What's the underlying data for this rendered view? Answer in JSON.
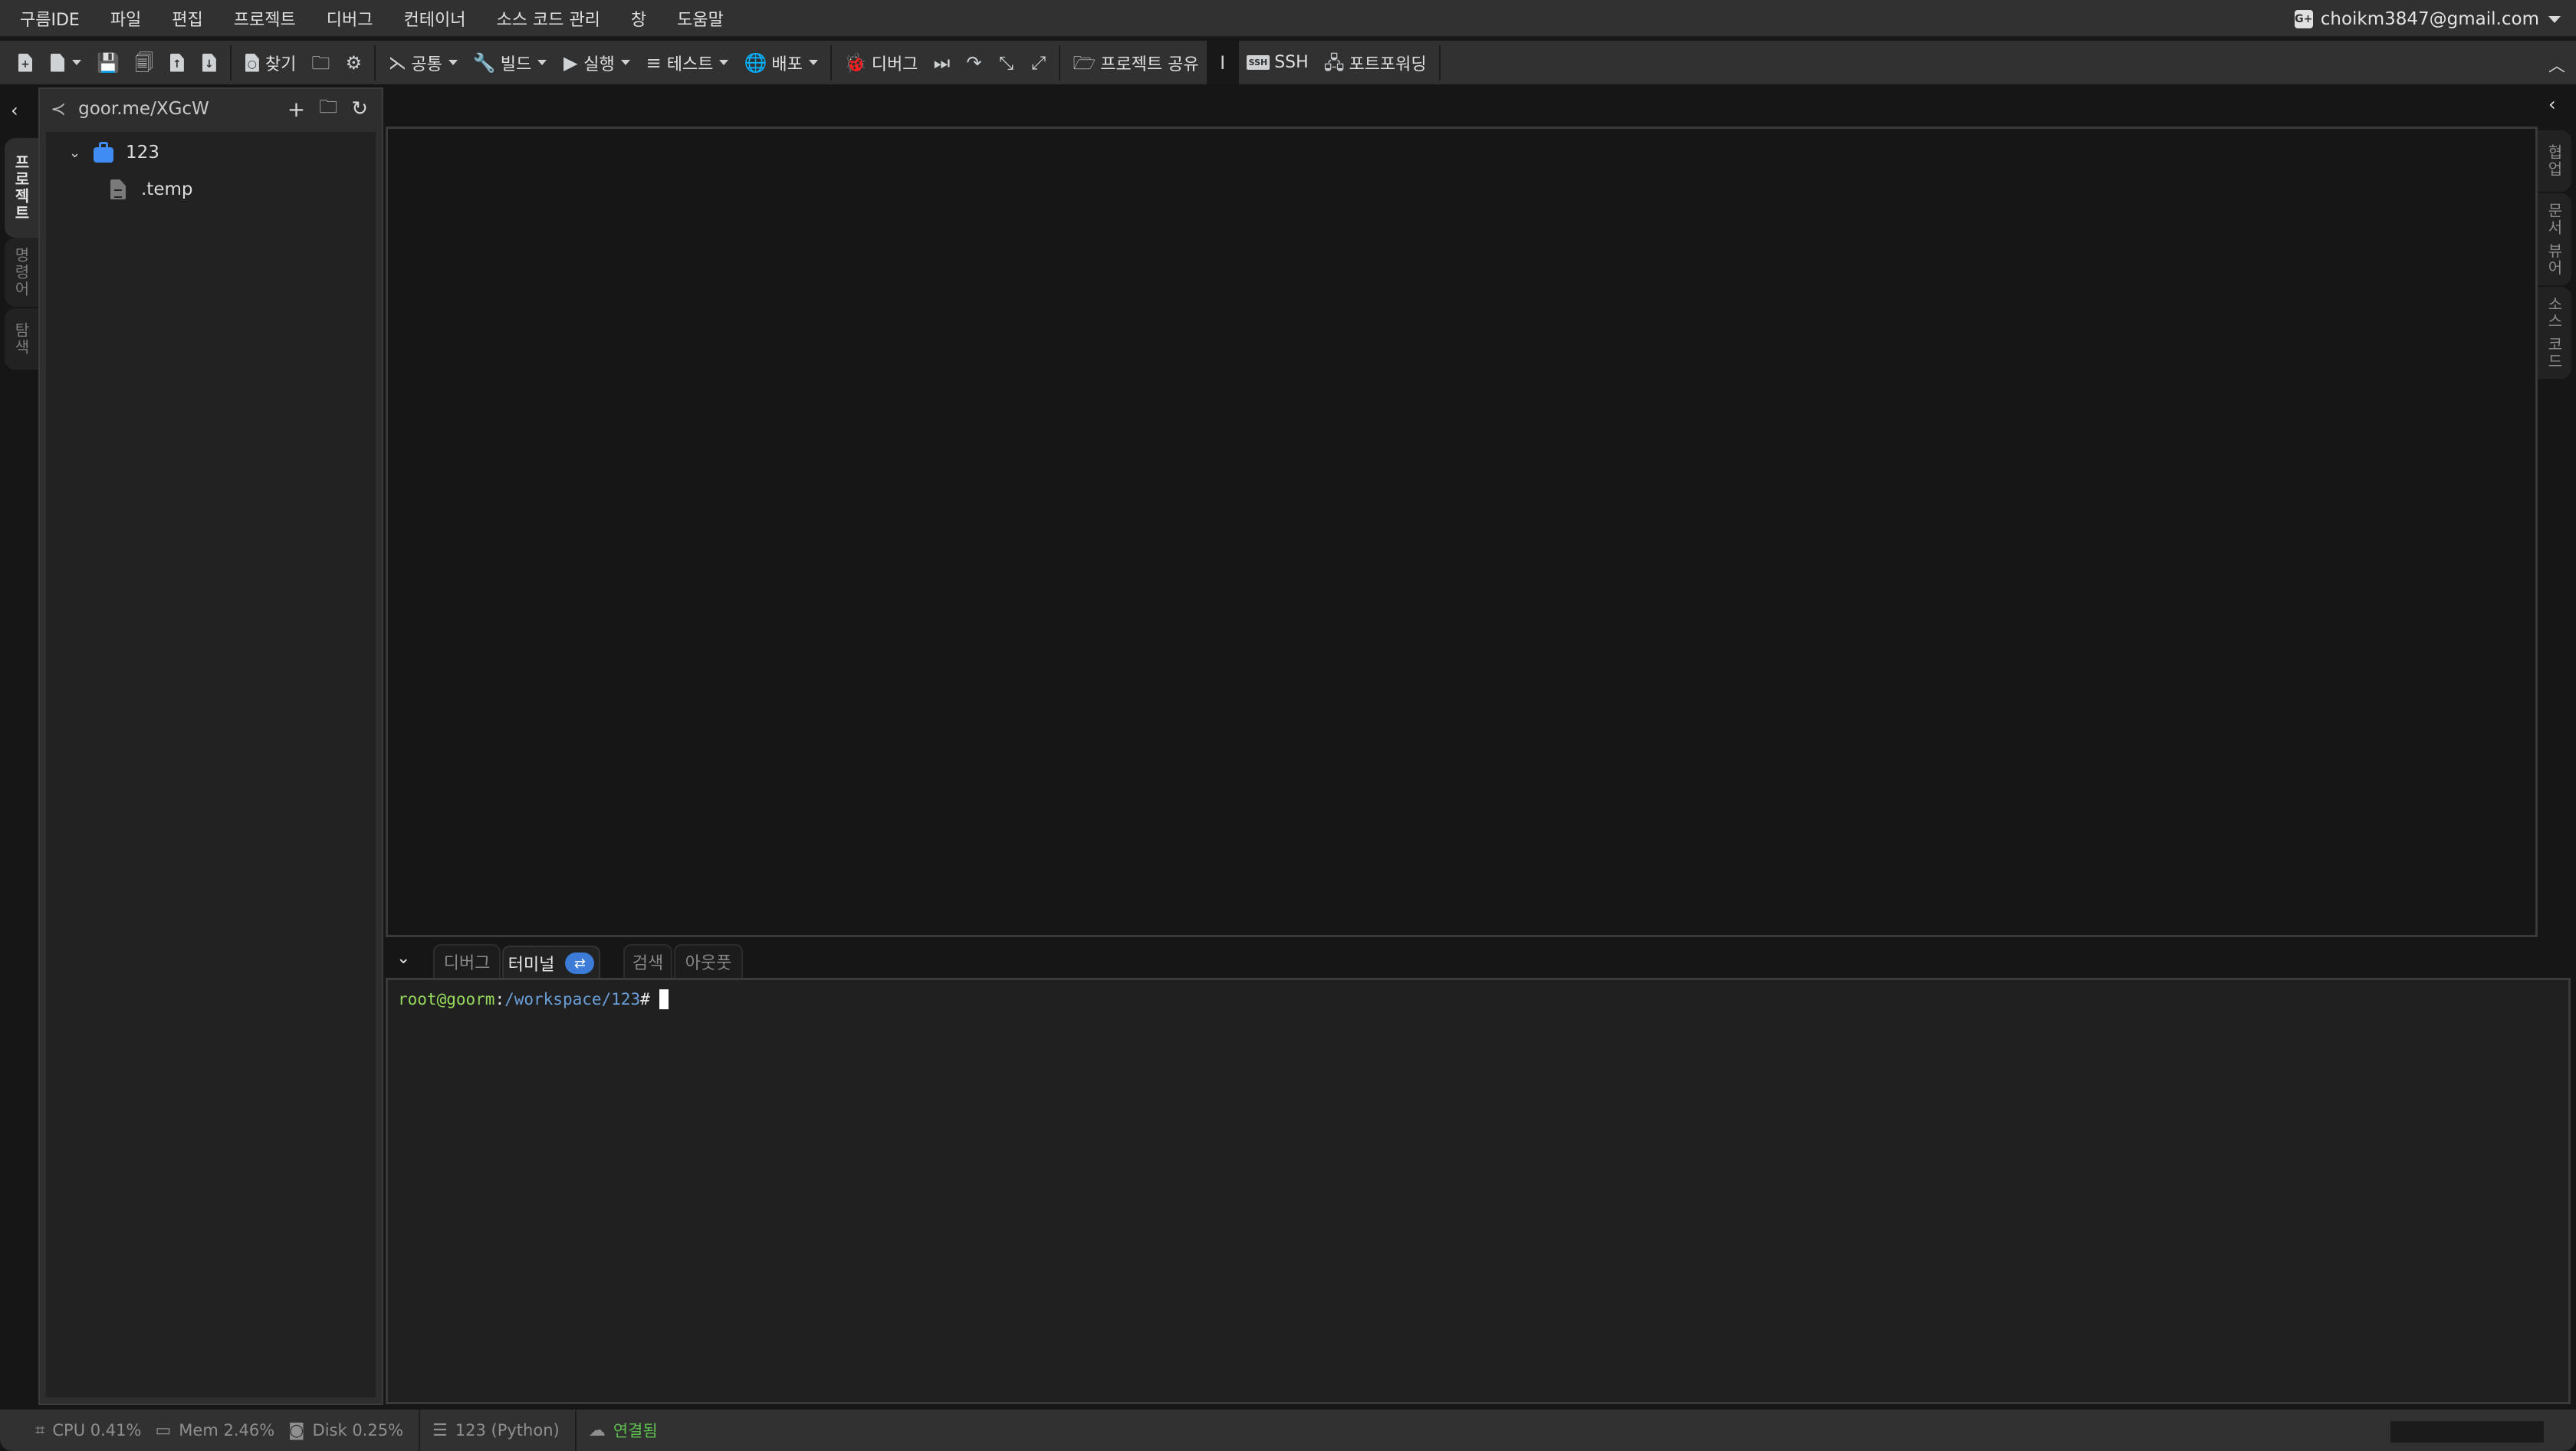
{
  "menubar": {
    "items": [
      "구름IDE",
      "파일",
      "편집",
      "프로젝트",
      "디버그",
      "컨테이너",
      "소스 코드 관리",
      "창",
      "도움말"
    ],
    "account": {
      "icon": "google-plus-icon",
      "email": "choikm3847@gmail.com"
    }
  },
  "toolbar": {
    "find": "찾기",
    "common": "공통",
    "build": "빌드",
    "run": "실행",
    "test": "테스트",
    "deploy": "배포",
    "debug": "디버그",
    "share_project": "프로젝트 공유",
    "ssh": "SSH",
    "port_forwarding": "포트포워딩"
  },
  "left_rail": {
    "tabs": [
      "프로젝트",
      "명령어",
      "탐색"
    ]
  },
  "sidebar": {
    "share_url": "goor.me/XGcW",
    "tree": [
      {
        "type": "folder",
        "name": "123",
        "expanded": true
      },
      {
        "type": "file",
        "name": ".temp"
      }
    ]
  },
  "right_rail": {
    "tabs": [
      "협업",
      "문서 뷰어",
      "소스 코드"
    ]
  },
  "bottom_panel": {
    "tabs": [
      {
        "label": "디버그",
        "active": false
      },
      {
        "label": "터미널",
        "active": true
      },
      {
        "label": "검색",
        "active": false
      },
      {
        "label": "아웃풋",
        "active": false
      }
    ],
    "terminal": {
      "user": "root@goorm",
      "colon": ":",
      "path": "/workspace/123",
      "prompt": "#"
    }
  },
  "statusbar": {
    "cpu": "CPU 0.41%",
    "mem": "Mem 2.46%",
    "disk": "Disk 0.25%",
    "container": "123 (Python)",
    "connection": "연결됨",
    "colors": {
      "connected": "#5fbf4f"
    }
  }
}
